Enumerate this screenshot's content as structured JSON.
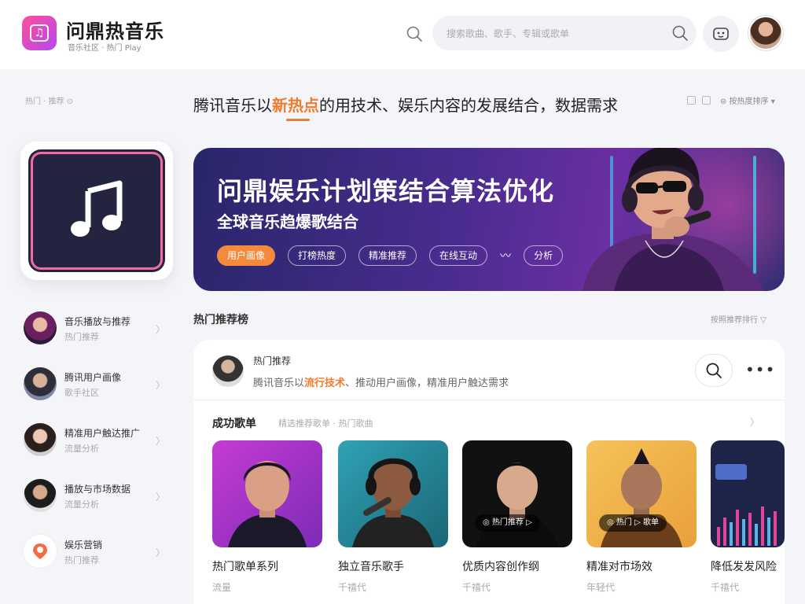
{
  "header": {
    "app_name": "问鼎热音乐",
    "app_subtitle": "音乐社区 · 热门 Play",
    "search_placeholder": "搜索歌曲、歌手、专辑或歌单"
  },
  "strip": {
    "left_label": "热门 · 推荐 ⊙",
    "headline_prefix": "腾讯音乐以",
    "headline_highlight": "新热点",
    "headline_suffix": "的用技术、娱乐内容的发展结合，数据需求",
    "sort_label": "⊜ 按热度排序 ▾"
  },
  "sidebar": {
    "items": [
      {
        "title": "音乐播放与推荐",
        "sub": "热门推荐",
        "arrow": "〉"
      },
      {
        "title": "腾讯用户画像",
        "sub": "歌手社区",
        "arrow": "〉"
      },
      {
        "title": "精准用户触达推广",
        "sub": "流量分析",
        "arrow": "〉"
      },
      {
        "title": "播放与市场数据",
        "sub": "流量分析",
        "arrow": "〉"
      },
      {
        "title": "娱乐营销",
        "sub": "热门推荐",
        "arrow": "〉"
      }
    ]
  },
  "banner": {
    "title": "问鼎娱乐计划策结合算法优化",
    "subtitle": "全球音乐趋爆歌结合",
    "tags": [
      "用户画像",
      "打榜热度",
      "精准推荐",
      "在线互动"
    ],
    "wave": "〰",
    "last_tag": "分析"
  },
  "trending": {
    "title": "热门推荐榜",
    "more": "按照推荐排行 ▽"
  },
  "post": {
    "author": "热门推荐",
    "text_prefix": "腾讯音乐以",
    "text_highlight": "流行技术",
    "text_suffix": "、推动用户画像，精准用户触达需求"
  },
  "songlist": {
    "title": "成功歌单",
    "subtitle": "精选推荐歌单 · 热门歌曲",
    "chevron": "〉",
    "cards": [
      {
        "title": "热门歌单系列",
        "sub": "流量",
        "badge": ""
      },
      {
        "title": "独立音乐歌手",
        "sub": "千禧代",
        "badge": ""
      },
      {
        "title": "优质内容创作纲",
        "sub": "千禧代",
        "badge": "◎ 热门推荐 ▷"
      },
      {
        "title": "精准对市场效",
        "sub": "年轻代",
        "badge": "◎ 热门 ▷ 歌单"
      },
      {
        "title": "降低发发风险",
        "sub": "千禧代",
        "badge": ""
      }
    ]
  },
  "colors": {
    "accent": "#f07b2c",
    "brand_gradient_start": "#ff4f9a",
    "brand_gradient_end": "#b447f0",
    "banner_dark": "#28266a"
  },
  "icons": {
    "logo": "music-note-icon",
    "search": "search-icon",
    "assistant": "robot-icon",
    "more": "more-dots-icon"
  }
}
